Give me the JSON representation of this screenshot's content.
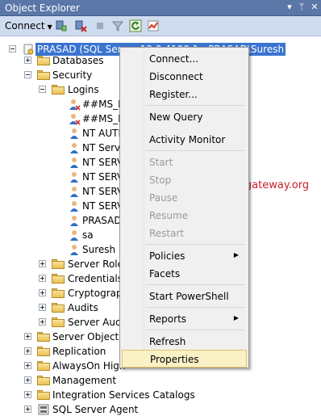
{
  "window": {
    "title": "Object Explorer"
  },
  "toolbar": {
    "connect_label": "Connect"
  },
  "tree": {
    "server": "PRASAD (SQL Server 12.0.4100.1 - PRASAD\\Suresh",
    "nodes": {
      "databases": "Databases",
      "security": "Security",
      "logins": "Logins",
      "login_1": "##MS_Po",
      "login_2": "##MS_Po",
      "login_3": "NT AUTH",
      "login_4": "NT Servi",
      "login_5": "NT SERV",
      "login_6": "NT SERV",
      "login_7": "NT SERV",
      "login_8": "NT SERV",
      "login_9": "PRASAD\\",
      "login_10": "sa",
      "login_11": "Suresh",
      "server_roles": "Server Roles",
      "credentials": "Credentials",
      "cryptographic": "Cryptograph",
      "audits": "Audits",
      "server_audit": "Server Audit",
      "server_objects": "Server Objects",
      "replication": "Replication",
      "alwayson": "AlwaysOn High",
      "management": "Management",
      "integration": "Integration Services Catalogs",
      "agent": "SQL Server Agent"
    }
  },
  "context_menu": {
    "connect": "Connect...",
    "disconnect": "Disconnect",
    "register": "Register...",
    "new_query": "New Query",
    "activity_monitor": "Activity Monitor",
    "start": "Start",
    "stop": "Stop",
    "pause": "Pause",
    "resume": "Resume",
    "restart": "Restart",
    "policies": "Policies",
    "facets": "Facets",
    "start_powershell": "Start PowerShell",
    "reports": "Reports",
    "refresh": "Refresh",
    "properties": "Properties"
  },
  "watermark": "©tutorialgateway.org",
  "colors": {
    "selection": "#3a74d0",
    "watermark": "#c8202a",
    "menu_hover": "#fbf1c6"
  }
}
